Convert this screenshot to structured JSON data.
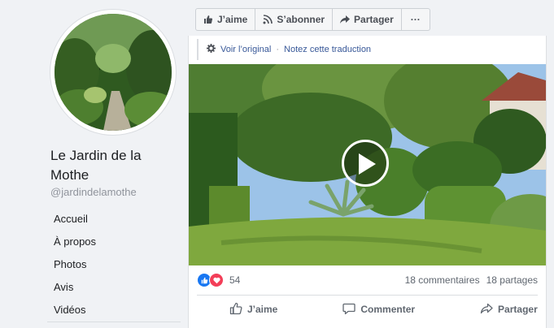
{
  "page": {
    "name": "Le Jardin de la Mothe",
    "handle": "@jardindelamothe"
  },
  "nav": {
    "items": [
      {
        "label": "Accueil"
      },
      {
        "label": "À propos"
      },
      {
        "label": "Photos"
      },
      {
        "label": "Avis"
      },
      {
        "label": "Vidéos"
      }
    ]
  },
  "actionbar": {
    "like_label": "J’aime",
    "subscribe_label": "S’abonner",
    "share_label": "Partager",
    "more_label": "···"
  },
  "post": {
    "translate": {
      "see_original": "Voir l’original",
      "separator": "·",
      "rate": "Notez cette traduction"
    },
    "reactions": {
      "count": "54",
      "types": [
        "like-icon",
        "love-icon"
      ]
    },
    "comments": "18 commentaires",
    "shares": "18 partages",
    "actions": {
      "like": "J’aime",
      "comment": "Commenter",
      "share": "Partager"
    }
  },
  "colors": {
    "link": "#385898",
    "like_blue": "#1877f2",
    "love_red": "#f33e58",
    "muted": "#606770"
  }
}
